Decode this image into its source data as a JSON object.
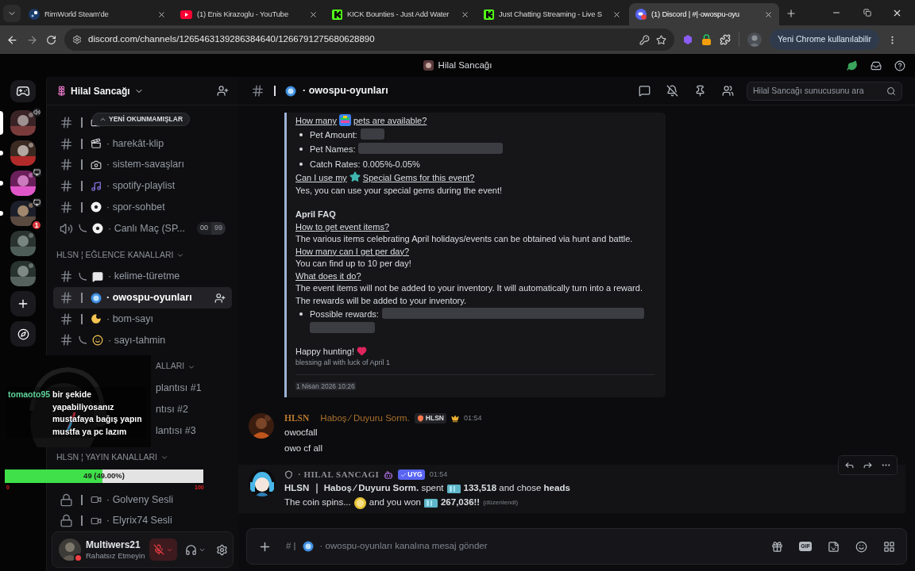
{
  "browser": {
    "tabs": [
      {
        "title": "RimWorld Steam'de",
        "selected": false
      },
      {
        "title": "(1) Enis Kirazoglu - YouTube",
        "selected": false
      },
      {
        "title": "KICK Bounties - Just Add Water",
        "selected": false
      },
      {
        "title": "Just Chatting Streaming - Live S",
        "selected": false
      },
      {
        "title": "(1) Discord | #|·owospu-oyu",
        "selected": true
      }
    ],
    "url": "discord.com/channels/1265463139286384640/1266791275680628890",
    "update_label": "Yeni Chrome kullanılabilir"
  },
  "app_title": "Hilal Sancağı",
  "servers": [
    {
      "selected": true,
      "unread": false
    },
    {
      "selected": false,
      "unread": true
    },
    {
      "selected": false,
      "unread": true
    },
    {
      "selected": false,
      "unread": true,
      "badge": "1"
    },
    {
      "selected": false,
      "unread": false
    },
    {
      "selected": false,
      "unread": false
    }
  ],
  "sidebar": {
    "server_name": "Hilal Sancağı",
    "unread_pill": "YENİ OKUNMAMIŞLAR",
    "items": [
      {
        "kind": "text",
        "selected": false
      },
      {
        "kind": "text",
        "name": "· harekât-klip",
        "selected": false
      },
      {
        "kind": "text",
        "name": "· sistem-savaşları",
        "selected": false
      },
      {
        "kind": "text",
        "name": "· spotify-playlist",
        "selected": false
      },
      {
        "kind": "text",
        "name": "· spor-sohbet",
        "selected": false
      },
      {
        "kind": "voice",
        "name": "· Canlı Maç (SP...",
        "counter": [
          "00",
          "99"
        ],
        "selected": false
      },
      {
        "kind": "category",
        "label": "HLSN ¦ EĞLENCE KANALLARI"
      },
      {
        "kind": "text",
        "name": "· kelime-türetme",
        "selected": false
      },
      {
        "kind": "text",
        "name": "· owospu-oyunları",
        "selected": true
      },
      {
        "kind": "text",
        "name": "· bom-sayı",
        "selected": false
      },
      {
        "kind": "text",
        "name": "· sayı-tahmin",
        "selected": false
      },
      {
        "kind": "partial_category",
        "label": "ALLARI"
      },
      {
        "kind": "partial",
        "name": "plantısı #1"
      },
      {
        "kind": "partial",
        "name": "ntısı #2"
      },
      {
        "kind": "partial",
        "name": "lantısı #3"
      },
      {
        "kind": "category",
        "label": "HLSN ¦ YAYIN KANALLARI"
      },
      {
        "kind": "locked",
        "name": "· Golveny Sesli",
        "selected": false
      },
      {
        "kind": "locked",
        "name": "· Elyrix74 Sesli",
        "selected": false
      }
    ]
  },
  "channel": {
    "name": "· owospu-oyunları",
    "search_placeholder": "Hilal Sancağı sunucusunu ara"
  },
  "embed": {
    "lines": [
      {
        "kind": "link",
        "text": "How many",
        "after": "pets are available?"
      },
      {
        "kind": "bullet",
        "text": "Pet Amount:",
        "spoiler": true
      },
      {
        "kind": "bullet",
        "text": "Pet Names:",
        "spoiler": true
      },
      {
        "kind": "bullet",
        "text": "Catch Rates: 0.005%-0.05%"
      },
      {
        "kind": "link",
        "text": "Can I use my",
        "after": "Special Gems for this event?"
      },
      {
        "kind": "text",
        "text": "Yes, you can use your special gems during the event!"
      },
      {
        "kind": "blank"
      },
      {
        "kind": "heading",
        "text": "April FAQ"
      },
      {
        "kind": "link",
        "text": "How to get event items?"
      },
      {
        "kind": "text",
        "text": "The various items celebrating April holidays/events can be obtained via hunt and battle."
      },
      {
        "kind": "link",
        "text": "How many can I get per day?"
      },
      {
        "kind": "text",
        "text": "You can find up to 10 per day!"
      },
      {
        "kind": "link",
        "text": "What does it do?"
      },
      {
        "kind": "text",
        "text": "The event items will not be added to your inventory. It will automatically turn into a reward. The rewards will be added to your inventory."
      },
      {
        "kind": "bullet",
        "text": "Possible rewards:",
        "spoiler": true
      },
      {
        "kind": "blank"
      },
      {
        "kind": "text",
        "text": "Happy hunting!"
      },
      {
        "kind": "small",
        "text": "blessing all with luck of April 1"
      }
    ],
    "timestamp": "1 Nisan 2026 10:26"
  },
  "messages": [
    {
      "kind": "user",
      "name": "HLSN",
      "nick": "Haboş ⁄ Duyuru Sorm.",
      "tag": "HLSN",
      "time": "01:54",
      "hovered": false,
      "lines": [
        [
          {
            "kind": "text",
            "text": "owocfall"
          }
        ],
        [
          {
            "kind": "text",
            "text": "owo cf all"
          }
        ]
      ]
    },
    {
      "kind": "bot",
      "name": "· HILAL SANCAGI",
      "tag": "UYG",
      "time": "01:54",
      "hovered": true,
      "lines": [
        [
          {
            "kind": "text",
            "text": "**HLSN ｜ Haboş ⁄ Duyuru Sorm.** spent"
          },
          {
            "kind": "cash"
          },
          {
            "kind": "text",
            "text": "**133,518** and chose **heads**"
          }
        ],
        [
          {
            "kind": "text",
            "text": "The coin spins..."
          },
          {
            "kind": "coin"
          },
          {
            "kind": "text",
            "text": "and you won"
          },
          {
            "kind": "cash"
          },
          {
            "kind": "text",
            "text": "**267,036!!**"
          },
          {
            "kind": "edited",
            "text": "(düzenlendi)"
          }
        ]
      ]
    }
  ],
  "composer": {
    "prefix": "# |",
    "placeholder": "· owospu-oyunları kanalına mesaj gönder",
    "gif_label": "GIF"
  },
  "user_panel": {
    "name": "Multiwers21",
    "status": "Rahatsız Etmeyin",
    "mic_muted": true
  },
  "overlay": {
    "goal": {
      "level": 0.49,
      "label": "49 (49.00%)",
      "min": "0",
      "max": "100"
    },
    "chat": {
      "user": "tomaoto95",
      "message": "bir şekide yapabiliyosanız mustafaya bağış yapın mustfa ya pc lazım"
    }
  }
}
